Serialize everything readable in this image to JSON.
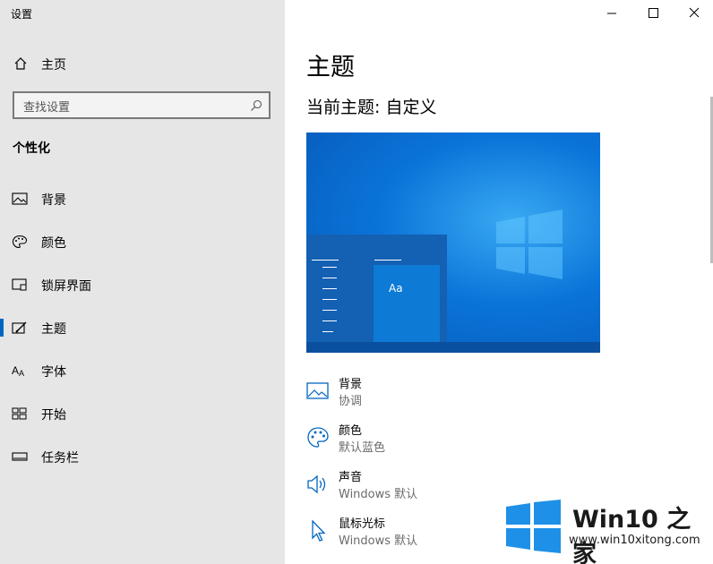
{
  "window": {
    "title": "设置",
    "controls": [
      "minimize",
      "maximize",
      "close"
    ]
  },
  "sidebar": {
    "home_label": "主页",
    "search_placeholder": "查找设置",
    "section_title": "个性化",
    "items": [
      {
        "label": "背景",
        "icon": "image-icon",
        "active": false
      },
      {
        "label": "颜色",
        "icon": "palette-icon",
        "active": false
      },
      {
        "label": "锁屏界面",
        "icon": "lock-screen-icon",
        "active": false
      },
      {
        "label": "主题",
        "icon": "theme-icon",
        "active": true
      },
      {
        "label": "字体",
        "icon": "font-icon",
        "active": false
      },
      {
        "label": "开始",
        "icon": "start-icon",
        "active": false
      },
      {
        "label": "任务栏",
        "icon": "taskbar-icon",
        "active": false
      }
    ]
  },
  "main": {
    "title": "主题",
    "current_theme": "当前主题: 自定义",
    "preview_text": "Aa",
    "settings": [
      {
        "label": "背景",
        "value": "协调",
        "icon": "image-icon"
      },
      {
        "label": "颜色",
        "value": "默认蓝色",
        "icon": "palette-icon"
      },
      {
        "label": "声音",
        "value": "Windows 默认",
        "icon": "speaker-icon"
      },
      {
        "label": "鼠标光标",
        "value": "Windows 默认",
        "icon": "cursor-icon"
      }
    ]
  },
  "watermark": {
    "brand": "Win10 之家",
    "url": "www.win10xitong.com",
    "logo_color": "#1e90e8"
  },
  "colors": {
    "accent": "#0067c0",
    "sidebar_bg": "#e6e6e6"
  }
}
